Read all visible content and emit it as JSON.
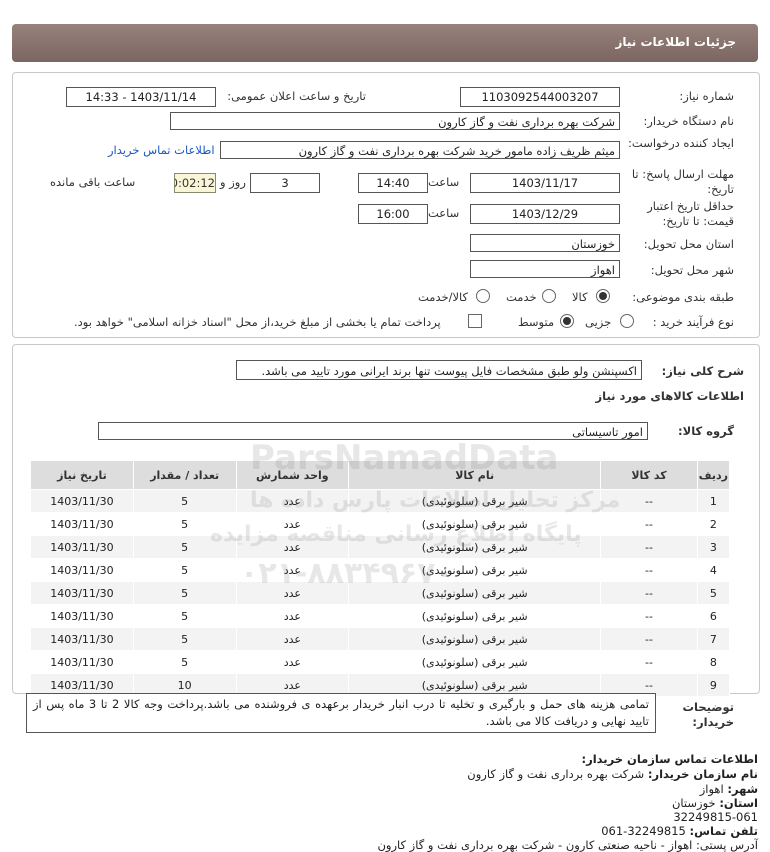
{
  "header": {
    "title": "جزئیات اطلاعات نیاز"
  },
  "info": {
    "need_number_label": "شماره نیاز:",
    "need_number": "1103092544003207",
    "announce_label": "تاریخ و ساعت اعلان عمومی:",
    "announce_value": "1403/11/14 - 14:33",
    "buyer_org_label": "نام دستگاه خریدار:",
    "buyer_org": "شرکت بهره برداری نفت و گاز کارون",
    "creator_label": "ایجاد کننده درخواست:",
    "creator": "میثم ظریف زاده مامور خرید شرکت بهره برداری نفت و گاز کارون",
    "contact_link": "اطلاعات تماس خریدار",
    "deadline_label": "مهلت ارسال پاسخ: تا تاریخ:",
    "deadline_date": "1403/11/17",
    "time_label": "ساعت",
    "deadline_time": "14:40",
    "days_value": "3",
    "days_label": "روز و",
    "timer": "00:02:12",
    "remaining_label": "ساعت باقی مانده",
    "validity_label": "حداقل تاریخ اعتبار قیمت: تا تاریخ:",
    "validity_date": "1403/12/29",
    "validity_time": "16:00",
    "province_label": "استان محل تحویل:",
    "province": "خوزستان",
    "city_label": "شهر محل تحویل:",
    "city": "اهواز",
    "category_label": "طبقه بندی موضوعی:",
    "category_options": [
      "کالا",
      "خدمت",
      "کالا/خدمت"
    ],
    "process_label": "نوع فرآیند خرید :",
    "process_options": [
      "جزیی",
      "متوسط"
    ],
    "treasury_note": "پرداخت تمام یا بخشی از مبلغ خرید،از محل \"اسناد خزانه اسلامی\" خواهد بود."
  },
  "description": {
    "label": "شرح کلی نیاز:",
    "text": "اکسپنشن ولو طبق مشخصات فایل پیوست تنها برند ایرانی مورد تایید می باشد."
  },
  "goods": {
    "section_title": "اطلاعات کالاهای مورد نیاز",
    "group_label": "گروه کالا:",
    "group_value": "امور تاسیساتی",
    "columns": [
      "ردیف",
      "کد کالا",
      "نام کالا",
      "واحد شمارش",
      "تعداد / مقدار",
      "تاریخ نیاز"
    ],
    "rows": [
      [
        "1",
        "--",
        "شیر برقی (سلونوئیدی)",
        "عدد",
        "5",
        "1403/11/30"
      ],
      [
        "2",
        "--",
        "شیر برقی (سلونوئیدی)",
        "عدد",
        "5",
        "1403/11/30"
      ],
      [
        "3",
        "--",
        "شیر برقی (سلونوئیدی)",
        "عدد",
        "5",
        "1403/11/30"
      ],
      [
        "4",
        "--",
        "شیر برقی (سلونوئیدی)",
        "عدد",
        "5",
        "1403/11/30"
      ],
      [
        "5",
        "--",
        "شیر برقی (سلونوئیدی)",
        "عدد",
        "5",
        "1403/11/30"
      ],
      [
        "6",
        "--",
        "شیر برقی (سلونوئیدی)",
        "عدد",
        "5",
        "1403/11/30"
      ],
      [
        "7",
        "--",
        "شیر برقی (سلونوئیدی)",
        "عدد",
        "5",
        "1403/11/30"
      ],
      [
        "8",
        "--",
        "شیر برقی (سلونوئیدی)",
        "عدد",
        "5",
        "1403/11/30"
      ],
      [
        "9",
        "--",
        "شیر برقی (سلونوئیدی)",
        "عدد",
        "10",
        "1403/11/30"
      ]
    ]
  },
  "buyer_notes": {
    "label": "توضیحات خریدار:",
    "text": "تمامی هزینه های حمل و بارگیری و تخلیه تا درب انبار خریدار برعهده ی فروشنده می باشد.پرداخت وجه کالا 2 تا 3 ماه پس از تایید نهایی و دریافت کالا می باشد."
  },
  "contact": {
    "title": "اطلاعات تماس سازمان خریدار:",
    "org_label": "نام سازمان خریدار:",
    "org": "شرکت بهره برداری نفت و گاز کارون",
    "city_label": "شهر:",
    "city": "اهواز",
    "province_label": "استان:",
    "province": "خوزستان",
    "postal_line": "32249815-061",
    "phone_label": "تلفن تماس:",
    "phone": "32249815-061",
    "address_partial": "آدرس پستی: اهواز - ناحیه صنعتی کارون - شرکت بهره برداری نفت و گاز کارون"
  },
  "watermark": {
    "brand": "ParsNamadData",
    "line1": "مرکز تحلیل اطلاعات پارس داده ها",
    "line2": "پایگاه اطلاع رسانی مناقصه مزایده",
    "phone": "۰۲۱-۸۸۳۴۹۶۷۰"
  }
}
